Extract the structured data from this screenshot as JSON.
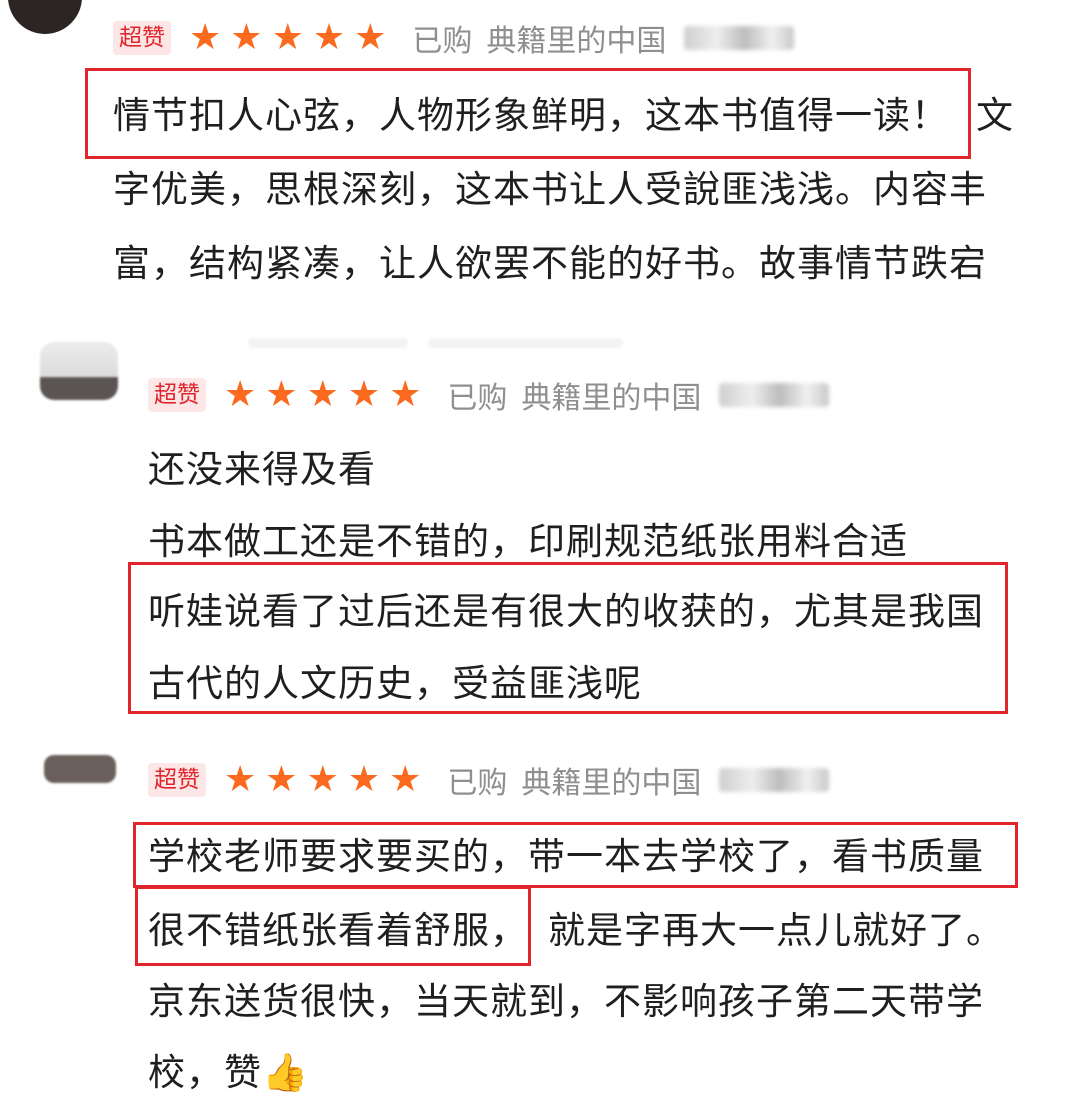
{
  "reviews": [
    {
      "badge": "超赞",
      "stars": 5,
      "purchased": "已购",
      "product": "典籍里的中国",
      "lines": [
        "情节扣人心弦，人物形象鲜明，这本书值得一读！",
        "文",
        "字优美，思根深刻，这本书让人受說匪浅浅。内容丰",
        "富，结构紧凑，让人欲罢不能的好书。故事情节跌宕"
      ]
    },
    {
      "badge": "超赞",
      "stars": 5,
      "purchased": "已购",
      "product": "典籍里的中国",
      "lines": [
        "还没来得及看",
        "书本做工还是不错的，印刷规范纸张用料合适",
        "听娃说看了过后还是有很大的收获的，尤其是我国",
        "古代的人文历史，受益匪浅呢"
      ]
    },
    {
      "badge": "超赞",
      "stars": 5,
      "purchased": "已购",
      "product": "典籍里的中国",
      "lines": [
        "学校老师要求要买的，带一本去学校了，看书质量",
        "很不错纸张看着舒服，",
        "就是字再大一点儿就好了。",
        "京东送货很快，当天就到，不影响孩子第二天带学",
        "校，赞👍"
      ]
    }
  ],
  "colors": {
    "highlight": "#e0262c",
    "star": "#fb6a1e",
    "badge_bg": "#fde6e6",
    "muted": "#8f8f8f"
  },
  "icons": {
    "star": "star-icon",
    "thumbs_up": "thumbs-up-emoji"
  }
}
